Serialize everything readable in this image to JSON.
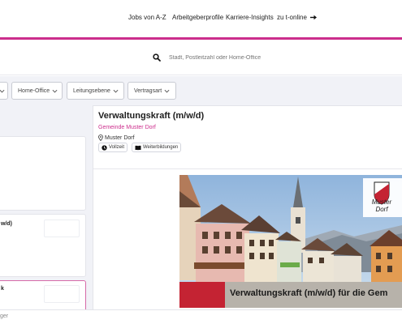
{
  "nav": {
    "items": [
      "Jobs von A-Z",
      "Arbeitgeberprofile",
      "Karriere-Insights",
      "zu t-online"
    ]
  },
  "search": {
    "placeholder": "Stadt, Postleitzahl oder Home-Office"
  },
  "filters": [
    "Home-Office",
    "Leitungsebene",
    "Vertragsart"
  ],
  "list": {
    "fragments": [
      "w/d)",
      "k"
    ]
  },
  "job": {
    "title": "Verwaltungskraft (m/w/d)",
    "employer": "Gemeinde Muster Dorf",
    "location": "Muster Dorf",
    "tags": [
      "Vollzeit",
      "Weiterbildungen"
    ]
  },
  "banner": {
    "text": "Verwaltungskraft (m/w/d) für die Gem",
    "crest_label": [
      "Muster",
      "Dorf"
    ]
  },
  "footer": {
    "text": "ger"
  },
  "colors": {
    "accent": "#cc2e8c",
    "page_bg": "#f1f2f7"
  }
}
